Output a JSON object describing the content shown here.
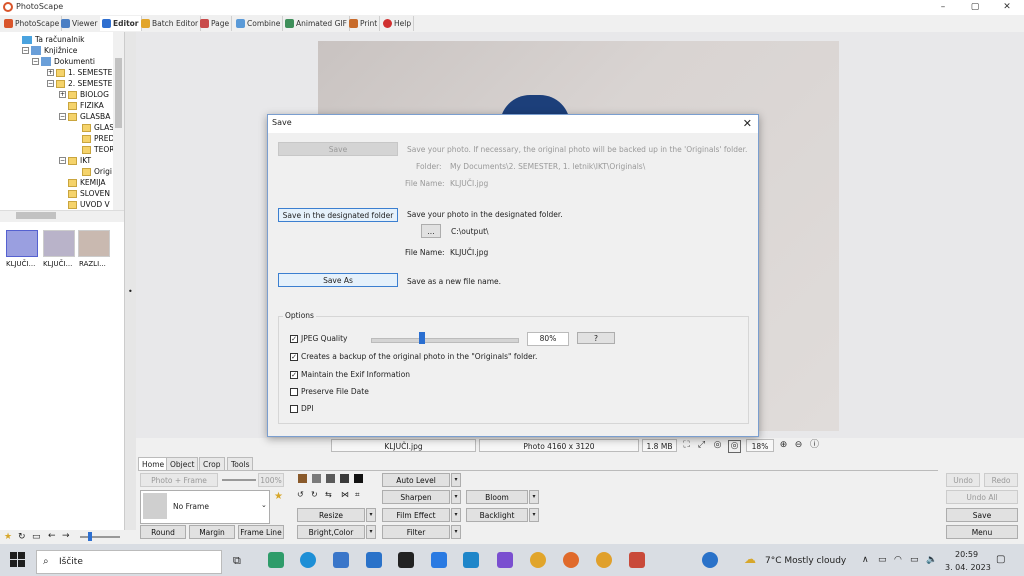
{
  "window": {
    "title": "PhotoScape",
    "minimize": "–",
    "maximize": "▢",
    "close": "✕"
  },
  "menu": [
    {
      "label": "PhotoScape",
      "icon": "photoscape-icon",
      "color": "#d9552b"
    },
    {
      "label": "Viewer",
      "icon": "viewer-icon",
      "color": "#4b7fc4"
    },
    {
      "label": "Editor",
      "icon": "editor-icon",
      "color": "#2f6fd0"
    },
    {
      "label": "Batch Editor",
      "icon": "batch-editor-icon",
      "color": "#e2a52b"
    },
    {
      "label": "Page",
      "icon": "page-icon",
      "color": "#c84a4a"
    },
    {
      "label": "Combine",
      "icon": "combine-icon",
      "color": "#5a9ad8"
    },
    {
      "label": "Animated GIF",
      "icon": "animated-gif-icon",
      "color": "#3e8f5a"
    },
    {
      "label": "Print",
      "icon": "print-icon",
      "color": "#c86b2b"
    },
    {
      "label": "Help",
      "icon": "help-icon",
      "color": "#d03030"
    }
  ],
  "tree": {
    "items": [
      {
        "label": "Ta računalnik",
        "icon": "pc"
      },
      {
        "label": "Knjižnice",
        "icon": "lib"
      },
      {
        "label": "Dokumenti",
        "icon": "lib"
      },
      {
        "label": "1. SEMESTER",
        "icon": "folder"
      },
      {
        "label": "2. SEMESTER",
        "icon": "folder"
      },
      {
        "label": "BIOLOG",
        "icon": "folder"
      },
      {
        "label": "FIZIKA",
        "icon": "folder"
      },
      {
        "label": "GLASBA",
        "icon": "folder"
      },
      {
        "label": "GLAS",
        "icon": "folder"
      },
      {
        "label": "PRED",
        "icon": "folder"
      },
      {
        "label": "TEOR",
        "icon": "folder"
      },
      {
        "label": "IKT",
        "icon": "folder"
      },
      {
        "label": "Origi",
        "icon": "folder"
      },
      {
        "label": "KEMIJA",
        "icon": "folder"
      },
      {
        "label": "SLOVEN",
        "icon": "folder"
      },
      {
        "label": "UVOD V",
        "icon": "folder"
      }
    ]
  },
  "thumbnails": [
    {
      "label": "KLJUČI..."
    },
    {
      "label": "KLJUČI..."
    },
    {
      "label": "RAZLI..."
    }
  ],
  "status": {
    "filename": "KLJUČI.jpg",
    "dimensions": "Photo 4160 x 3120",
    "size": "1.8 MB",
    "zoom": "18%"
  },
  "tool_tabs": [
    "Home",
    "Object",
    "Crop",
    "Tools"
  ],
  "tools": {
    "photo_frame": "Photo + Frame",
    "frame_zoom": "100%",
    "frame_name": "No Frame",
    "round": "Round",
    "margin": "Margin",
    "frame_line": "Frame Line",
    "auto_level": "Auto Level",
    "sharpen": "Sharpen",
    "bloom": "Bloom",
    "resize": "Resize",
    "film_effect": "Film Effect",
    "backlight": "Backlight",
    "bright_color": "Bright,Color",
    "filter": "Filter",
    "undo": "Undo",
    "redo": "Redo",
    "undo_all": "Undo All",
    "save": "Save",
    "menu": "Menu"
  },
  "dialog": {
    "title": "Save",
    "save_btn": "Save",
    "save_desc": "Save your photo. If necessary, the original photo will be backed up in the 'Originals' folder.",
    "folder_label": "Folder:",
    "folder_value": "My Documents\\2. SEMESTER, 1. letnik\\IKT\\Originals\\",
    "filename_label": "File Name:",
    "filename_value": "KLJUČI.jpg",
    "designated_btn": "Save in the designated folder",
    "designated_desc": "Save your photo in the designated folder.",
    "browse_btn": "...",
    "output_path": "C:\\output\\",
    "filename2_label": "File Name:",
    "filename2_value": "KLJUČI.jpg",
    "saveas_btn": "Save As",
    "saveas_desc": "Save as a new file name.",
    "options_label": "Options",
    "jpeg_quality_label": "JPEG Quality",
    "jpeg_quality_value": "80%",
    "jpeg_quality_fraction": 0.8,
    "help_btn": "?",
    "opt_backup": "Creates a backup of the original photo in the \"Originals\" folder.",
    "opt_exif": "Maintain the Exif Information",
    "opt_date": "Preserve File Date",
    "opt_dpi": "DPI",
    "checks": {
      "jpeg": true,
      "backup": true,
      "exif": true,
      "date": false,
      "dpi": false
    }
  },
  "taskbar": {
    "search_placeholder": "Iščite",
    "weather": "7°C  Mostly cloudy",
    "time": "20:59",
    "date": "3. 04. 2023"
  }
}
